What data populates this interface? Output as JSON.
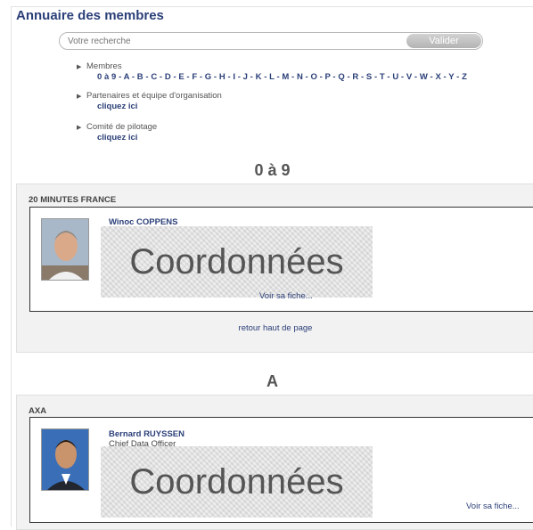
{
  "page": {
    "title": "Annuaire des membres"
  },
  "search": {
    "placeholder": "Votre recherche",
    "submit_label": "Valider"
  },
  "nav": {
    "members_label": "Membres",
    "letters": [
      "0 à 9",
      "A",
      "B",
      "C",
      "D",
      "E",
      "F",
      "G",
      "H",
      "I",
      "J",
      "K",
      "L",
      "M",
      "N",
      "O",
      "P",
      "Q",
      "R",
      "S",
      "T",
      "U",
      "V",
      "W",
      "X",
      "Y",
      "Z"
    ],
    "partners_label": "Partenaires et équipe d'organisation",
    "partners_link": "cliquez ici",
    "committee_label": "Comité de pilotage",
    "committee_link": "cliquez ici"
  },
  "sections": [
    {
      "heading": "0 à 9",
      "company": "20 MINUTES FRANCE",
      "member_name": "Winoc COPPENS",
      "member_job": "",
      "overlay": "Coordonnées",
      "fiche_label": "Voir sa fiche...",
      "back_label": "retour haut de page"
    },
    {
      "heading": "A",
      "company": "AXA",
      "member_name": "Bernard RUYSSEN",
      "member_job": "Chief Data Officer",
      "overlay": "Coordonnées",
      "fiche_label": "Voir sa fiche..."
    }
  ],
  "colors": {
    "link": "#2b3f78",
    "panel_bg": "#f2f2f2"
  }
}
